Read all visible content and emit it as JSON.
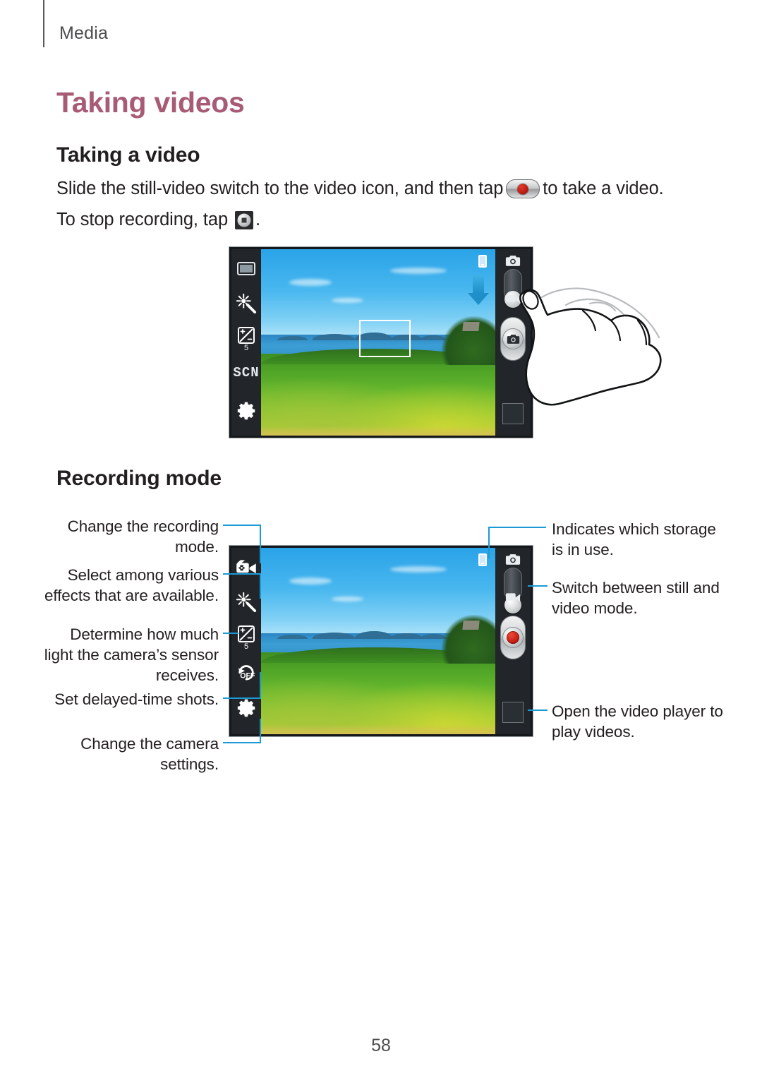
{
  "page": {
    "running_head": "Media",
    "page_number": "58"
  },
  "headings": {
    "h1": "Taking videos",
    "taking_a_video": "Taking a video",
    "recording_mode": "Recording mode"
  },
  "body": {
    "line1_before_icon": "Slide the still-video switch to the video icon, and then tap",
    "line1_after_icon": "to take a video.",
    "line2_before_icon": "To stop recording, tap",
    "line2_after_icon": ".",
    "icon_record_name": "record-switch-icon",
    "icon_stop_name": "stop-recording-icon"
  },
  "figure_taking_video": {
    "alt": "Camera preview with hand sliding the still-video switch",
    "left_rail_icons": [
      {
        "name": "shooting-mode-icon",
        "label": "Shooting mode"
      },
      {
        "name": "effects-wand-icon",
        "label": "Effects"
      },
      {
        "name": "exposure-icon",
        "label": "Exposure",
        "value": "5"
      },
      {
        "name": "scene-mode-icon",
        "label": "SCN"
      },
      {
        "name": "camera-settings-gear-icon",
        "label": "Settings"
      }
    ],
    "right_rail": {
      "still_mode_icon": "still-camera-icon",
      "video_mode_icon": "video-camera-icon",
      "switch_name": "still-video-switch",
      "shutter_name": "shutter-button",
      "gallery_name": "gallery-thumbnail"
    },
    "storage_indicator": "storage-indicator-icon",
    "hint_arrow": "slide-down-arrow",
    "focus_box": "focus-frame"
  },
  "figure_recording_mode": {
    "alt": "Camcorder preview annotated with callouts",
    "left_rail_icons": [
      {
        "name": "recording-mode-icon",
        "label": "Recording mode"
      },
      {
        "name": "effects-wand-icon",
        "label": "Effects"
      },
      {
        "name": "exposure-icon",
        "label": "Exposure",
        "value": "5"
      },
      {
        "name": "timer-off-icon",
        "label": "OFF"
      },
      {
        "name": "camera-settings-gear-icon",
        "label": "Settings"
      }
    ],
    "right_rail": {
      "still_mode_icon": "still-camera-icon",
      "video_mode_icon": "video-camera-icon",
      "switch_name": "still-video-switch",
      "record_name": "record-button",
      "gallery_name": "gallery-thumbnail"
    },
    "storage_indicator": "storage-indicator-icon"
  },
  "callouts": {
    "left": [
      {
        "id": "recording-mode",
        "text": "Change the recording mode."
      },
      {
        "id": "effects",
        "text": "Select among various effects that are available."
      },
      {
        "id": "exposure",
        "text": "Determine how much light the camera’s sensor receives."
      },
      {
        "id": "timer",
        "text": "Set delayed-time shots."
      },
      {
        "id": "settings",
        "text": "Change the camera settings."
      }
    ],
    "right": [
      {
        "id": "storage",
        "text": "Indicates which storage is in use."
      },
      {
        "id": "mode-switch",
        "text": "Switch between still and video mode."
      },
      {
        "id": "video-player",
        "text": "Open the video player to play videos."
      }
    ]
  },
  "colors": {
    "heading_accent": "#a85c74",
    "leader_line": "#1b9ad6",
    "text": "#231f20",
    "running_head": "#4d4d4f",
    "record_red": "#c8160b"
  }
}
